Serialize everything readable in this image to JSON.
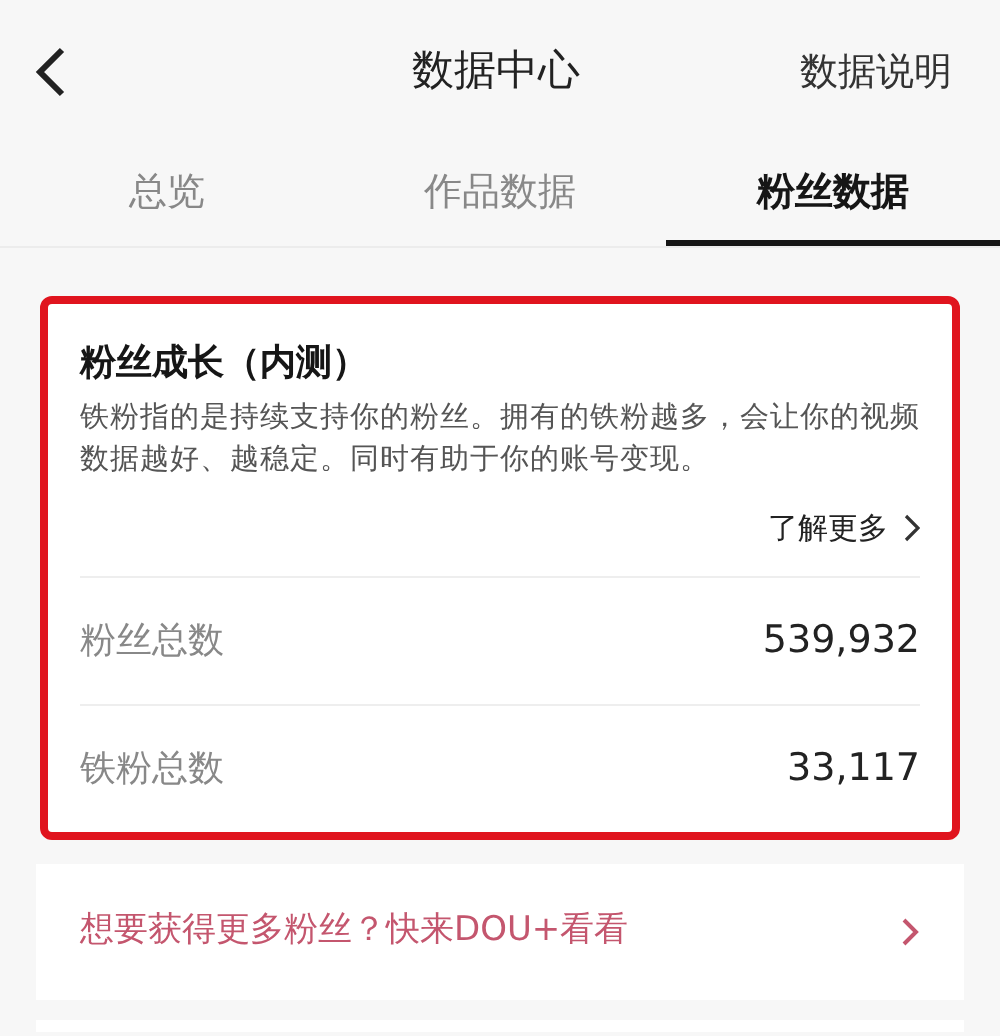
{
  "header": {
    "title": "数据中心",
    "action": "数据说明"
  },
  "tabs": [
    {
      "label": "总览",
      "selected": false
    },
    {
      "label": "作品数据",
      "selected": false
    },
    {
      "label": "粉丝数据",
      "selected": true
    }
  ],
  "card": {
    "highlighted": true,
    "title": "粉丝成长（内测）",
    "description": "铁粉指的是持续支持你的粉丝。拥有的铁粉越多，会让你的视频数据越好、越稳定。同时有助于你的账号变现。",
    "more_link": "了解更多",
    "stats": [
      {
        "label": "粉丝总数",
        "value": "539,932"
      },
      {
        "label": "铁粉总数",
        "value": "33,117"
      }
    ]
  },
  "promo": {
    "text": "想要获得更多粉丝？快来DOU+看看"
  }
}
